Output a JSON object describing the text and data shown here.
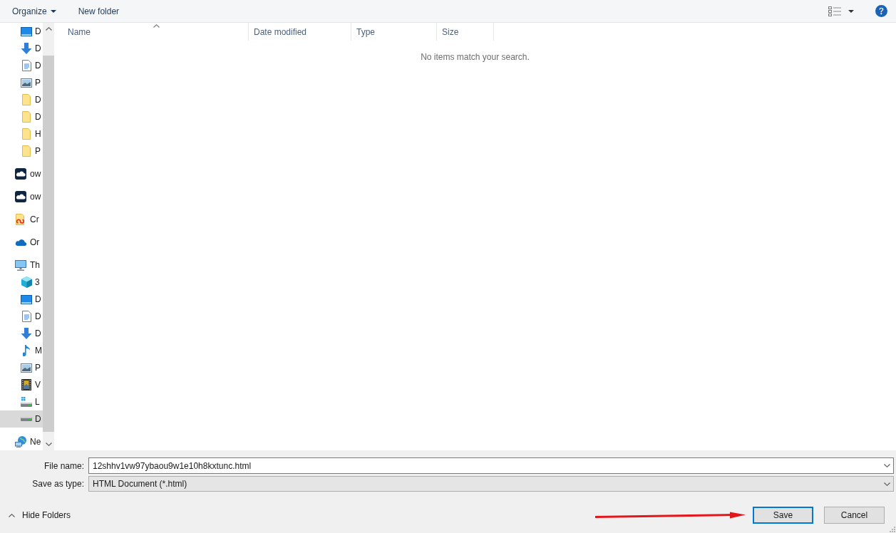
{
  "toolbar": {
    "buttons": [
      {
        "label": "Organize",
        "menu": true
      },
      {
        "label": "New folder",
        "menu": false
      }
    ]
  },
  "nav_pane": {
    "items": [
      {
        "children": [
          {
            "label": "D",
            "kind": "desktop",
            "selected": false
          },
          {
            "label": "D",
            "kind": "downloads",
            "selected": false
          },
          {
            "label": "D",
            "kind": "documents",
            "selected": false
          },
          {
            "label": "P",
            "kind": "pictures",
            "selected": false
          },
          {
            "label": "D",
            "kind": "folder",
            "selected": false
          },
          {
            "label": "D",
            "kind": "folder",
            "selected": false
          },
          {
            "label": "H",
            "kind": "folder",
            "selected": false
          },
          {
            "label": "P",
            "kind": "folder",
            "selected": false
          }
        ]
      },
      {
        "label": "ow",
        "kind": "cloudtile",
        "selected": false
      },
      {
        "label": "ow",
        "kind": "cloudtile",
        "selected": false
      },
      {
        "label": "Cr",
        "kind": "ccfolder",
        "selected": false
      },
      {
        "label": "Or",
        "kind": "onedrive",
        "selected": false
      },
      {
        "label": "Th",
        "kind": "computer",
        "selected": false,
        "children": [
          {
            "label": "3",
            "kind": "cube",
            "selected": false
          },
          {
            "label": "D",
            "kind": "desktop",
            "selected": false
          },
          {
            "label": "D",
            "kind": "documents",
            "selected": false
          },
          {
            "label": "D",
            "kind": "downloads",
            "selected": false
          },
          {
            "label": "M",
            "kind": "music",
            "selected": false
          },
          {
            "label": "P",
            "kind": "pictures",
            "selected": false
          },
          {
            "label": "V",
            "kind": "videos",
            "selected": false
          },
          {
            "label": "L",
            "kind": "systemdrive",
            "selected": false
          },
          {
            "label": "D",
            "kind": "drive",
            "selected": true
          }
        ]
      },
      {
        "label": "Ne",
        "kind": "network",
        "selected": false
      }
    ]
  },
  "file_list": {
    "columns": [
      {
        "label": "Name",
        "sorted": true
      },
      {
        "label": "Date modified",
        "sorted": false
      },
      {
        "label": "Type",
        "sorted": false
      },
      {
        "label": "Size",
        "sorted": false
      }
    ],
    "empty_message": "No items match your search."
  },
  "file_name": {
    "label": "File name:",
    "value": "12shhv1vw97ybaou9w1e10h8kxtunc.html"
  },
  "save_as_type": {
    "label": "Save as type:",
    "value": "HTML Document (*.html)"
  },
  "hide_folders": {
    "label": "Hide Folders"
  },
  "buttons": [
    {
      "label": "Save",
      "default": true
    },
    {
      "label": "Cancel",
      "default": false
    }
  ]
}
